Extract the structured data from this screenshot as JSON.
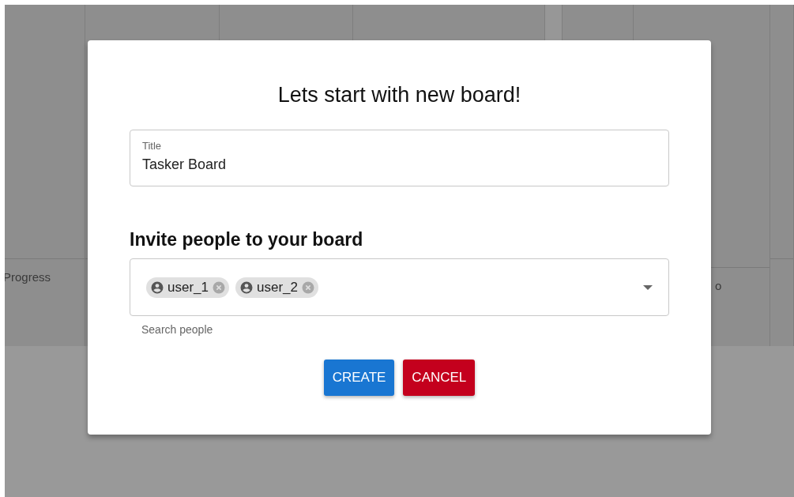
{
  "board": {
    "columns": [
      {
        "title": "Progress",
        "kind": "low"
      },
      {
        "kind": "plain"
      },
      {
        "kind": "plain"
      },
      {
        "kind": "plain"
      },
      {
        "kind": "strip"
      },
      {
        "kind": "plain"
      },
      {
        "title": "o",
        "kind": "high"
      },
      {
        "kind": "plain"
      }
    ]
  },
  "dialog": {
    "title": "Lets start with new board!",
    "title_field": {
      "label": "Title",
      "value": "Tasker Board"
    },
    "invite": {
      "heading": "Invite people to your board",
      "chips": [
        {
          "label": "user_1"
        },
        {
          "label": "user_2"
        }
      ],
      "helper": "Search people"
    },
    "buttons": [
      {
        "label": "CREATE",
        "kind": "primary"
      },
      {
        "label": "CANCEL",
        "kind": "danger"
      }
    ]
  }
}
